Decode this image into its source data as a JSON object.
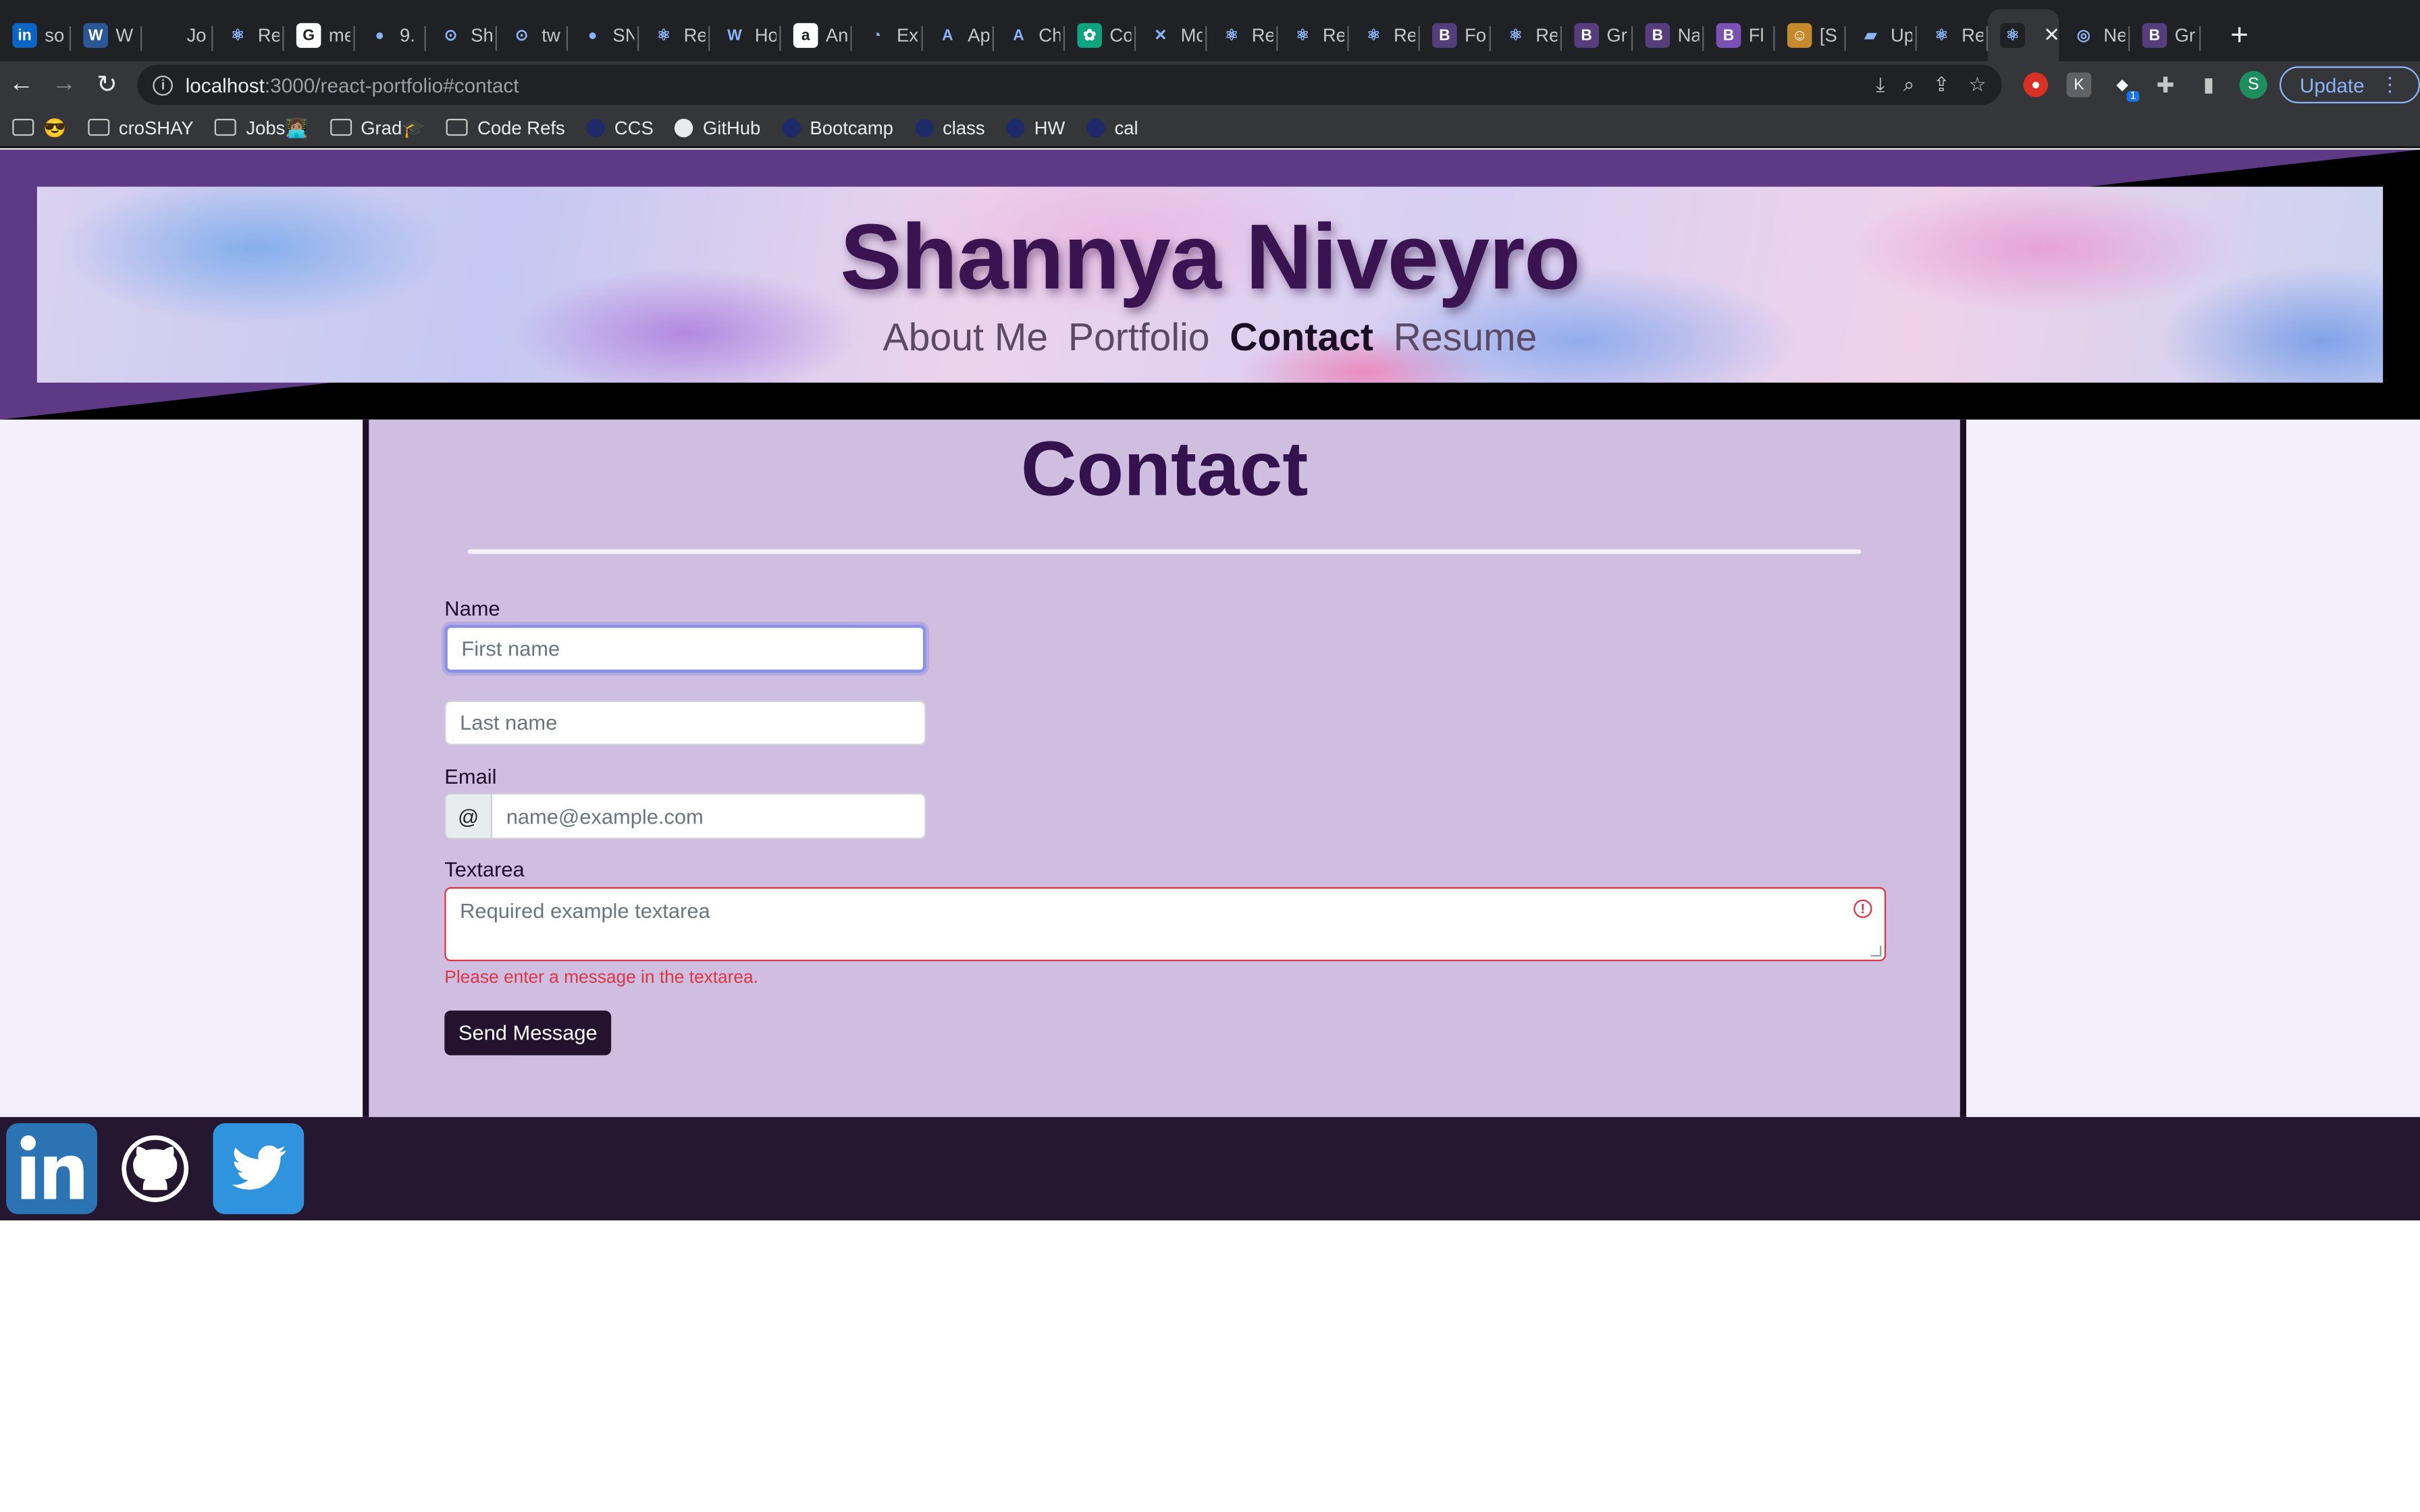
{
  "browser": {
    "tabs": [
      {
        "fav": "in",
        "color": "#0a66c2",
        "title": "so"
      },
      {
        "fav": "W",
        "color": "#2b5797",
        "title": "W"
      },
      {
        "fav": "",
        "color": "#202124",
        "title": "Jo"
      },
      {
        "fav": "⚛",
        "color": "#202124",
        "title": "Re"
      },
      {
        "fav": "G",
        "color": "#ffffff",
        "title": "me"
      },
      {
        "fav": "●",
        "color": "#202124",
        "title": "9."
      },
      {
        "fav": "⊙",
        "color": "#202124",
        "title": "Sh"
      },
      {
        "fav": "⊙",
        "color": "#202124",
        "title": "tw"
      },
      {
        "fav": "●",
        "color": "#202124",
        "title": "SN"
      },
      {
        "fav": "⚛",
        "color": "#202124",
        "title": "Re"
      },
      {
        "fav": "W",
        "color": "#202124",
        "title": "Ho"
      },
      {
        "fav": "a",
        "color": "#ffffff",
        "title": "An"
      },
      {
        "fav": "◔",
        "color": "#202124",
        "title": "Ex"
      },
      {
        "fav": "A",
        "color": "#202124",
        "title": "Ap"
      },
      {
        "fav": "A",
        "color": "#202124",
        "title": "Ch"
      },
      {
        "fav": "✿",
        "color": "#10a37f",
        "title": "Co"
      },
      {
        "fav": "✕",
        "color": "#202124",
        "title": "Mc"
      },
      {
        "fav": "⚛",
        "color": "#202124",
        "title": "Re"
      },
      {
        "fav": "⚛",
        "color": "#202124",
        "title": "Re"
      },
      {
        "fav": "⚛",
        "color": "#202124",
        "title": "Re"
      },
      {
        "fav": "B",
        "color": "#563d7c",
        "title": "Fo"
      },
      {
        "fav": "⚛",
        "color": "#202124",
        "title": "Re"
      },
      {
        "fav": "B",
        "color": "#563d7c",
        "title": "Gr"
      },
      {
        "fav": "B",
        "color": "#563d7c",
        "title": "Na"
      },
      {
        "fav": "B",
        "color": "#7952b3",
        "title": "Fl"
      },
      {
        "fav": "☺",
        "color": "#c58a2b",
        "title": "[S"
      },
      {
        "fav": "▰",
        "color": "#202124",
        "title": "Up"
      },
      {
        "fav": "⚛",
        "color": "#202124",
        "title": "Re"
      },
      {
        "fav": "⚛",
        "color": "#202124",
        "title": "",
        "active": true
      },
      {
        "fav": "◎",
        "color": "#202124",
        "title": "Ne"
      },
      {
        "fav": "B",
        "color": "#563d7c",
        "title": "Gr"
      }
    ],
    "close_glyph": "✕",
    "new_tab_glyph": "+",
    "url_host": "localhost",
    "url_path": ":3000/react-portfolio#contact",
    "update_label": "Update",
    "profile_initial": "S",
    "ext_badge": "1",
    "bookmarks": [
      {
        "type": "folder",
        "label": "😎"
      },
      {
        "type": "folder",
        "label": "croSHAY"
      },
      {
        "type": "folder",
        "label": "Jobs👩🏽‍💻"
      },
      {
        "type": "folder",
        "label": "Grad🎓"
      },
      {
        "type": "folder",
        "label": "Code Refs"
      },
      {
        "type": "site",
        "label": "CCS"
      },
      {
        "type": "github",
        "label": "GitHub"
      },
      {
        "type": "site",
        "label": "Bootcamp"
      },
      {
        "type": "site",
        "label": "class"
      },
      {
        "type": "site",
        "label": "HW"
      },
      {
        "type": "site",
        "label": "cal"
      }
    ]
  },
  "site": {
    "title": "Shannya Niveyro",
    "nav": [
      {
        "label": "About Me",
        "active": false
      },
      {
        "label": "Portfolio",
        "active": false
      },
      {
        "label": "Contact",
        "active": true
      },
      {
        "label": "Resume",
        "active": false
      }
    ],
    "contact": {
      "heading": "Contact",
      "name_label": "Name",
      "first_name_placeholder": "First name",
      "last_name_placeholder": "Last name",
      "email_label": "Email",
      "email_prefix": "@",
      "email_placeholder": "name@example.com",
      "textarea_label": "Textarea",
      "textarea_placeholder": "Required example textarea",
      "textarea_error": "Please enter a message in the textarea.",
      "submit_label": "Send Message"
    },
    "social": [
      "linkedin-icon",
      "github-icon",
      "twitter-icon"
    ],
    "colors": {
      "accent": "#34124d",
      "card": "#cfbedf",
      "footer": "#25172f",
      "error": "#dc3545"
    }
  }
}
